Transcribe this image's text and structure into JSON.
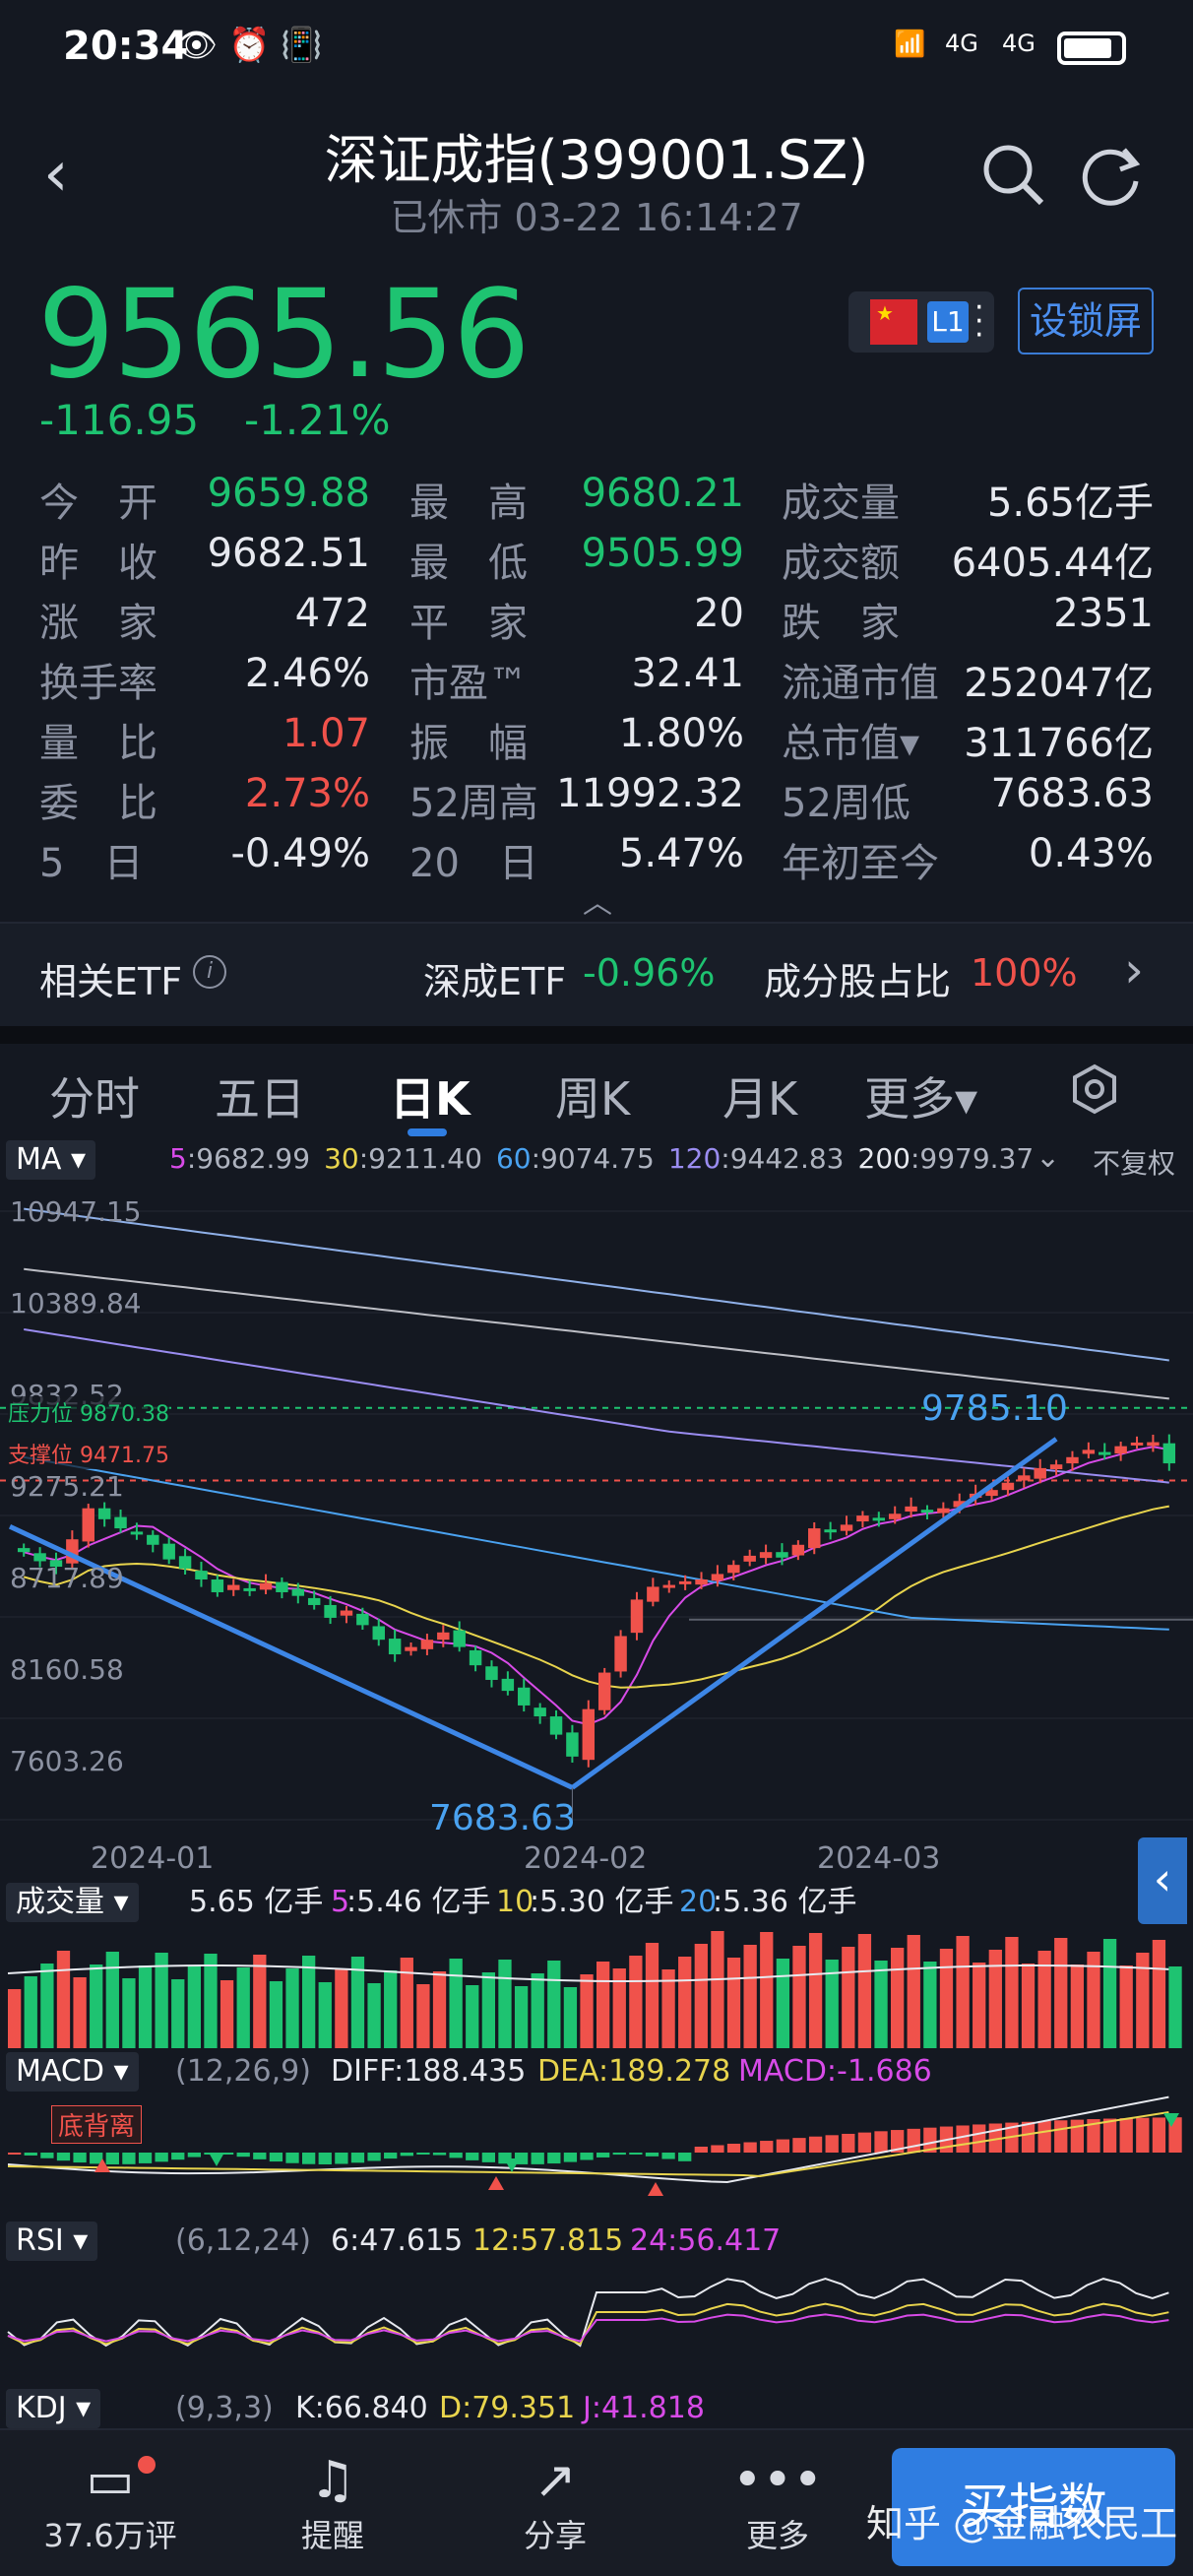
{
  "status_bar": {
    "time": "20:34",
    "icons_left": "👁 ⏰ 📳",
    "net1": "4G",
    "net2": "4G"
  },
  "header": {
    "title": "深证成指(399001.SZ)",
    "subtitle": "已休市 03-22 16:14:27",
    "lock_label": "设锁屏",
    "level_badge": "L1"
  },
  "quote": {
    "price": "9565.56",
    "change": "-116.95",
    "change_pct": "-1.21%"
  },
  "stats": [
    [
      {
        "label": "今　开",
        "value": "9659.88",
        "color": "g"
      },
      {
        "label": "最　高",
        "value": "9680.21",
        "color": "g"
      },
      {
        "label": "成交量",
        "value": "5.65亿手",
        "color": "w"
      }
    ],
    [
      {
        "label": "昨　收",
        "value": "9682.51",
        "color": "w"
      },
      {
        "label": "最　低",
        "value": "9505.99",
        "color": "g"
      },
      {
        "label": "成交额",
        "value": "6405.44亿",
        "color": "w"
      }
    ],
    [
      {
        "label": "涨　家",
        "value": "472",
        "color": "w"
      },
      {
        "label": "平　家",
        "value": "20",
        "color": "w"
      },
      {
        "label": "跌　家",
        "value": "2351",
        "color": "w"
      }
    ],
    [
      {
        "label": "换手率",
        "value": "2.46%",
        "color": "w"
      },
      {
        "label": "市盈™",
        "value": "32.41",
        "color": "w"
      },
      {
        "label": "流通市值",
        "value": "252047亿",
        "color": "w"
      }
    ],
    [
      {
        "label": "量　比",
        "value": "1.07",
        "color": "r"
      },
      {
        "label": "振　幅",
        "value": "1.80%",
        "color": "w"
      },
      {
        "label": "总市值▾",
        "value": "311766亿",
        "color": "w"
      }
    ],
    [
      {
        "label": "委　比",
        "value": "2.73%",
        "color": "r"
      },
      {
        "label": "52周高",
        "value": "11992.32",
        "color": "w"
      },
      {
        "label": "52周低",
        "value": "7683.63",
        "color": "w"
      }
    ],
    [
      {
        "label": "5　日",
        "value": "-0.49%",
        "color": "w"
      },
      {
        "label": "20　日",
        "value": "5.47%",
        "color": "w"
      },
      {
        "label": "年初至今",
        "value": "0.43%",
        "color": "w"
      }
    ]
  ],
  "etf": {
    "label": "相关ETF",
    "etf_name": "深成ETF",
    "etf_change": "-0.96%",
    "component_label": "成分股占比",
    "component_value": "100%"
  },
  "tabs": [
    "分时",
    "五日",
    "日K",
    "周K",
    "月K",
    "更多▾"
  ],
  "active_tab": 2,
  "ma": {
    "chip": "MA ▾",
    "items": [
      {
        "k": "5",
        "v": ":9682.99",
        "c": "p"
      },
      {
        "k": "30",
        "v": ":9211.40",
        "c": "y"
      },
      {
        "k": "60",
        "v": ":9074.75",
        "c": "b"
      },
      {
        "k": "120",
        "v": ":9442.83",
        "c": "v"
      },
      {
        "k": "200",
        "v": ":9979.37",
        "c": "w"
      }
    ],
    "adjust": "不复权"
  },
  "price_axis": [
    "10947.15",
    "10389.84",
    "9832.52",
    "9275.21",
    "8717.89",
    "8160.58",
    "7603.26"
  ],
  "resistance": "压力位 9870.38",
  "support": "支撑位 9471.75",
  "high_label": "9785.10",
  "low_label": "7683.63",
  "dates": [
    "2024-01",
    "2024-02",
    "2024-03"
  ],
  "volume": {
    "chip": "成交量 ▾",
    "total": "5.65 亿手",
    "ma5k": "5",
    "ma5": ":5.46 亿手",
    "ma10k": "10",
    "ma10": ":5.30 亿手",
    "ma20k": "20",
    "ma20": ":5.36 亿手"
  },
  "macd": {
    "chip": "MACD ▾",
    "params": "(12,26,9)",
    "diff": "DIFF:188.435",
    "dea": "DEA:189.278",
    "macd": "MACD:-1.686",
    "divergence": "底背离"
  },
  "rsi": {
    "chip": "RSI ▾",
    "params": "(6,12,24)",
    "r6": "6:47.615",
    "r12": "12:57.815",
    "r24": "24:56.417"
  },
  "kdj": {
    "chip": "KDJ ▾",
    "params": "(9,3,3)",
    "k": "K:66.840",
    "d": "D:79.351",
    "j": "J:41.818"
  },
  "bottom_nav": [
    {
      "icon": "comment-icon",
      "glyph": "💬",
      "label": "37.6万评"
    },
    {
      "icon": "bell-icon",
      "glyph": "🔔",
      "label": "提醒"
    },
    {
      "icon": "share-icon",
      "glyph": "↗",
      "label": "分享"
    },
    {
      "icon": "more-icon",
      "glyph": "•••",
      "label": "更多"
    }
  ],
  "buy_label": "买指数",
  "watermark": "知乎 @金融农民工",
  "colors": {
    "up": "#f0524b",
    "down": "#1ec371",
    "accent": "#2f7de1",
    "bg": "#141821"
  },
  "chart_data": {
    "type": "candlestick",
    "y_range": [
      7603.26,
      10947.15
    ],
    "closes": [
      9080,
      9030,
      9000,
      9150,
      9320,
      9260,
      9210,
      9180,
      9120,
      9040,
      8990,
      8930,
      8860,
      8900,
      8880,
      8910,
      8860,
      8840,
      8790,
      8720,
      8760,
      8680,
      8600,
      8520,
      8560,
      8600,
      8640,
      8560,
      8460,
      8380,
      8320,
      8240,
      8180,
      8080,
      7960,
      8220,
      8420,
      8620,
      8820,
      8890,
      8900,
      8920,
      8930,
      8960,
      9010,
      9060,
      9080,
      9050,
      9120,
      9210,
      9190,
      9230,
      9280,
      9260,
      9290,
      9330,
      9300,
      9320,
      9360,
      9400,
      9420,
      9460,
      9500,
      9540,
      9560,
      9600,
      9640,
      9620,
      9660,
      9680,
      9682,
      9566
    ],
    "ma_lines": {
      "5": "#d84be8",
      "30": "#e8d44d",
      "60": "#4aa2f0",
      "120": "#9a8cf0",
      "200": "#e7e9ef"
    },
    "high": 9785.1,
    "low": 7683.63
  }
}
